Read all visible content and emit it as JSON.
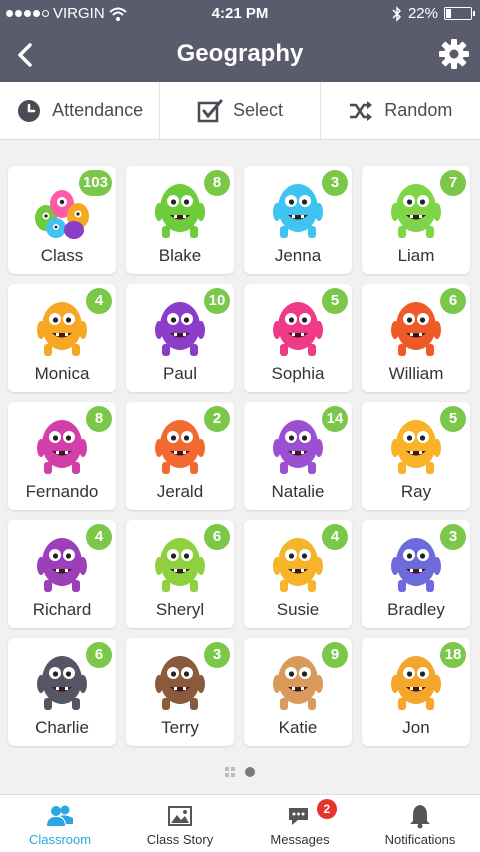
{
  "status_bar": {
    "carrier": "VIRGIN",
    "time": "4:21 PM",
    "battery": "22%"
  },
  "nav": {
    "title": "Geography"
  },
  "toolbar": {
    "attendance": "Attendance",
    "select": "Select",
    "random": "Random"
  },
  "students": [
    {
      "name": "Class",
      "points": "103",
      "color": "#ff5aa5",
      "icon": "class-group-monster-icon"
    },
    {
      "name": "Blake",
      "points": "8",
      "color": "#6ecb3c",
      "icon": "monster-icon"
    },
    {
      "name": "Jenna",
      "points": "3",
      "color": "#3fc3f0",
      "icon": "monster-icon"
    },
    {
      "name": "Liam",
      "points": "7",
      "color": "#7fd44a",
      "icon": "monster-icon"
    },
    {
      "name": "Monica",
      "points": "4",
      "color": "#f7a823",
      "icon": "monster-icon"
    },
    {
      "name": "Paul",
      "points": "10",
      "color": "#8b3cc9",
      "icon": "monster-icon"
    },
    {
      "name": "Sophia",
      "points": "5",
      "color": "#ef3b87",
      "icon": "monster-icon"
    },
    {
      "name": "William",
      "points": "6",
      "color": "#f05a28",
      "icon": "monster-icon"
    },
    {
      "name": "Fernando",
      "points": "8",
      "color": "#d23fa8",
      "icon": "monster-icon"
    },
    {
      "name": "Jerald",
      "points": "2",
      "color": "#f26a2f",
      "icon": "monster-icon"
    },
    {
      "name": "Natalie",
      "points": "14",
      "color": "#9b4fd1",
      "icon": "monster-icon"
    },
    {
      "name": "Ray",
      "points": "5",
      "color": "#f9b22a",
      "icon": "monster-icon"
    },
    {
      "name": "Richard",
      "points": "4",
      "color": "#9c3fb8",
      "icon": "monster-icon"
    },
    {
      "name": "Sheryl",
      "points": "6",
      "color": "#8ed13f",
      "icon": "monster-icon"
    },
    {
      "name": "Susie",
      "points": "4",
      "color": "#f6b42a",
      "icon": "monster-icon"
    },
    {
      "name": "Bradley",
      "points": "3",
      "color": "#6c6bd9",
      "icon": "monster-icon"
    },
    {
      "name": "Charlie",
      "points": "6",
      "color": "#555566",
      "icon": "monster-icon"
    },
    {
      "name": "Terry",
      "points": "3",
      "color": "#8b5a3c",
      "icon": "monster-icon"
    },
    {
      "name": "Katie",
      "points": "9",
      "color": "#d99a5b",
      "icon": "monster-icon"
    },
    {
      "name": "Jon",
      "points": "18",
      "color": "#f4a52a",
      "icon": "monster-icon"
    }
  ],
  "tabs": [
    {
      "label": "Classroom",
      "icon": "people-icon",
      "active": true
    },
    {
      "label": "Class Story",
      "icon": "photo-icon",
      "active": false
    },
    {
      "label": "Messages",
      "icon": "chat-icon",
      "active": false,
      "badge": "2"
    },
    {
      "label": "Notifications",
      "icon": "bell-icon",
      "active": false
    }
  ],
  "colors": {
    "header": "#5a5c6e",
    "badge": "#7bc74a",
    "active_tab": "#2aa7e0",
    "alert": "#e8322c"
  }
}
